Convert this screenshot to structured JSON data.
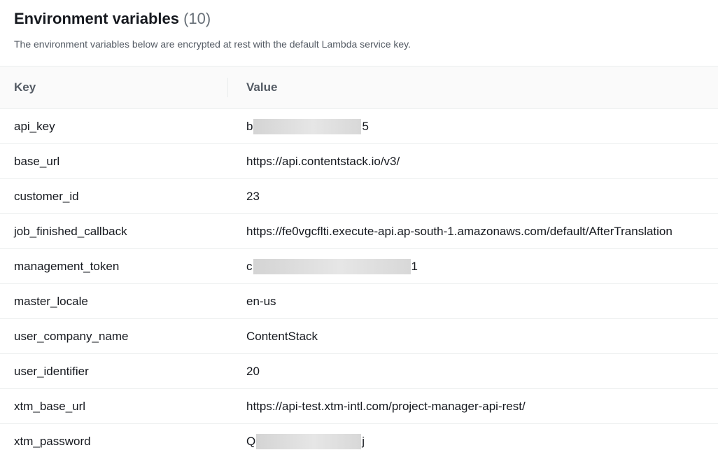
{
  "section": {
    "title": "Environment variables",
    "count": "(10)",
    "description": "The environment variables below are encrypted at rest with the default Lambda service key."
  },
  "table": {
    "columns": [
      "Key",
      "Value"
    ],
    "rows": [
      {
        "key": "api_key",
        "value_start": "b",
        "value_end": "5",
        "redacted": true
      },
      {
        "key": "base_url",
        "value": "https://api.contentstack.io/v3/",
        "redacted": false
      },
      {
        "key": "customer_id",
        "value": "23",
        "redacted": false
      },
      {
        "key": "job_finished_callback",
        "value": "https://fe0vgcflti.execute-api.ap-south-1.amazonaws.com/default/AfterTranslation",
        "redacted": false
      },
      {
        "key": "management_token",
        "value_start": "c",
        "value_end": "1",
        "redacted": true
      },
      {
        "key": "master_locale",
        "value": "en-us",
        "redacted": false
      },
      {
        "key": "user_company_name",
        "value": "ContentStack",
        "redacted": false
      },
      {
        "key": "user_identifier",
        "value": "20",
        "redacted": false
      },
      {
        "key": "xtm_base_url",
        "value": "https://api-test.xtm-intl.com/project-manager-api-rest/",
        "redacted": false
      },
      {
        "key": "xtm_password",
        "value_start": "Q",
        "value_end": "j",
        "redacted": true
      }
    ]
  }
}
